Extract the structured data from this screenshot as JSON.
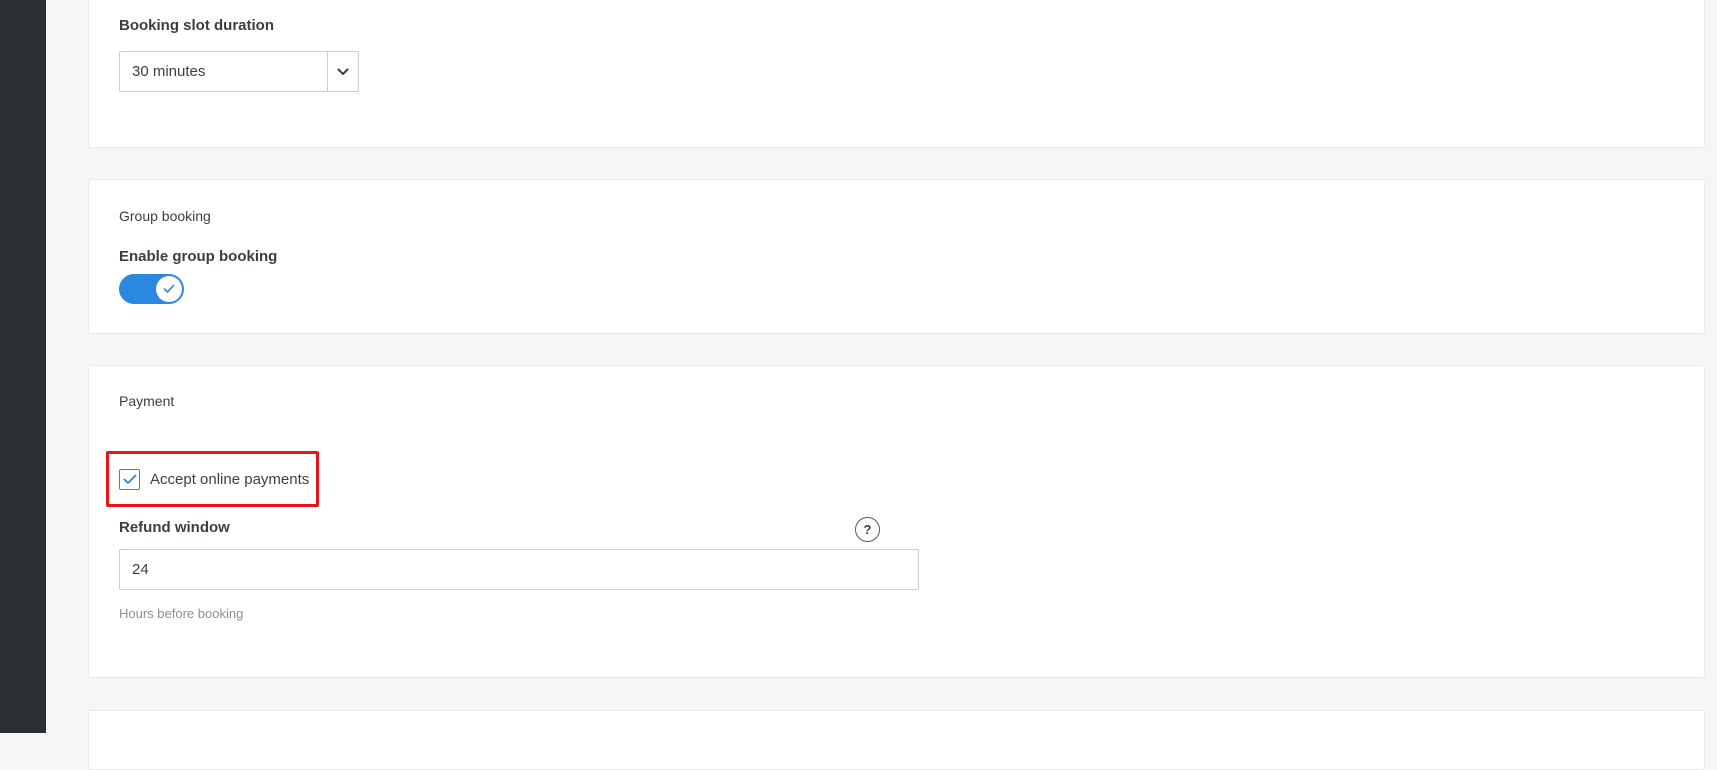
{
  "booking_slot": {
    "label": "Booking slot duration",
    "selected": "30 minutes",
    "chevron_icon": "chevron-down-icon"
  },
  "group_booking": {
    "section_title": "Group booking",
    "toggle_label": "Enable group booking",
    "toggle_on": true,
    "accent": "#2b88e0"
  },
  "payment": {
    "section_title": "Payment",
    "accept_label": "Accept online payments",
    "accept_checked": true,
    "refund_label": "Refund window",
    "refund_value": "24",
    "help_glyph": "?",
    "hint": "Hours before booking",
    "highlight_color": "#e8131b"
  }
}
